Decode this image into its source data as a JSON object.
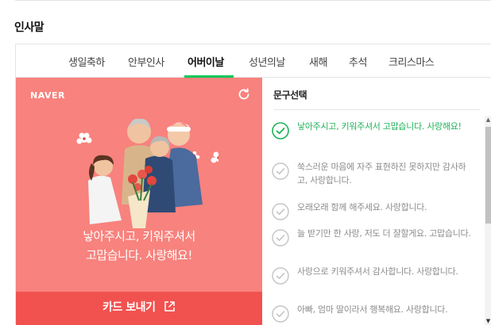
{
  "section_title": "인사말",
  "tabs": [
    {
      "label": "생일축하"
    },
    {
      "label": "안부인사"
    },
    {
      "label": "어버이날",
      "active": true
    },
    {
      "label": "성년의날"
    },
    {
      "label": "새해"
    },
    {
      "label": "추석"
    },
    {
      "label": "크리스마스"
    }
  ],
  "card": {
    "brand": "NAVER",
    "message_line1": "낳아주시고, 키워주셔서",
    "message_line2": "고맙습니다. 사랑해요!",
    "send_label": "카드 보내기",
    "background_color": "#f8827d",
    "button_color": "#f1524f"
  },
  "phrases": {
    "title": "문구선택",
    "items": [
      {
        "text": "낳아주시고, 키워주셔서 고맙습니다. 사랑해요!",
        "selected": true
      },
      {
        "text": "쑥스러운 마음에 자주 표현하진 못하지만 감사하고, 사랑합니다.",
        "selected": false
      },
      {
        "text": "오래오래 함께 해주세요. 사랑합니다.",
        "selected": false
      },
      {
        "text": "늘 받기만 한 사랑, 저도 더 잘할게요. 고맙습니다.",
        "selected": false
      },
      {
        "text": "사랑으로 키워주셔서 감사합니다. 사랑합니다.",
        "selected": false
      },
      {
        "text": "아빠, 엄마 딸이라서 행복해요. 사랑합니다.",
        "selected": false
      }
    ]
  },
  "colors": {
    "accent": "#03c75a",
    "selected_text": "#20b15a"
  }
}
